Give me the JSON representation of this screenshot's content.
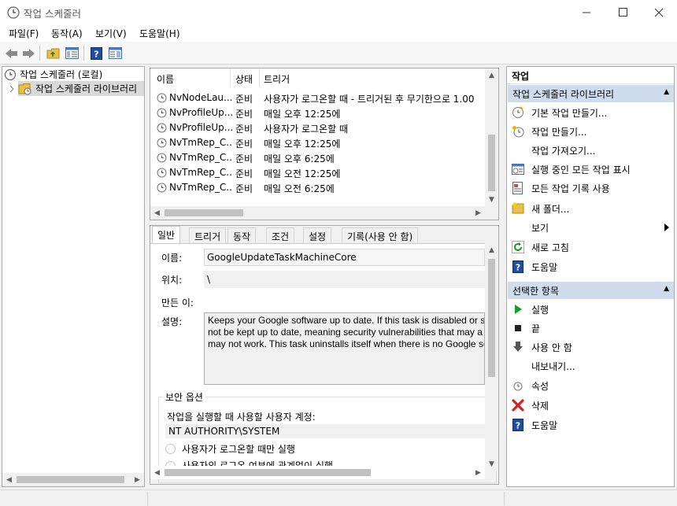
{
  "window": {
    "title": "작업 스케줄러"
  },
  "menu": [
    "파일(F)",
    "동작(A)",
    "보기(V)",
    "도움말(H)"
  ],
  "tree": {
    "root": "작업 스케줄러 (로컬)",
    "child": "작업 스케줄러 라이브러리"
  },
  "task_list": {
    "columns": [
      "이름",
      "상태",
      "트리거"
    ],
    "rows": [
      {
        "name": "NvNodeLau...",
        "status": "준비",
        "trigger": "사용자가 로그온할 때 - 트리거된 후 무기한으로 1.00"
      },
      {
        "name": "NvProfileUp...",
        "status": "준비",
        "trigger": "매일 오후 12:25에"
      },
      {
        "name": "NvProfileUp...",
        "status": "준비",
        "trigger": "사용자가 로그온할 때"
      },
      {
        "name": "NvTmRep_C...",
        "status": "준비",
        "trigger": "매일 오후 12:25에"
      },
      {
        "name": "NvTmRep_C...",
        "status": "준비",
        "trigger": "매일 오후 6:25에"
      },
      {
        "name": "NvTmRep_C...",
        "status": "준비",
        "trigger": "매일 오전 12:25에"
      },
      {
        "name": "NvTmRep_C...",
        "status": "준비",
        "trigger": "매일 오전 6:25에"
      }
    ]
  },
  "detail": {
    "tabs": [
      "일반",
      "트리거",
      "동작",
      "조건",
      "설정",
      "기록(사용 안 함)"
    ],
    "labels": {
      "name": "이름:",
      "location": "위치:",
      "author": "만든 이:",
      "description": "설명:"
    },
    "name_value": "GoogleUpdateTaskMachineCore",
    "location_value": "\\",
    "description_lines": [
      "Keeps your Google software up to date. If this task is disabled or st",
      "not be kept up to date, meaning security vulnerabilities that may a",
      "may not work. This task uninstalls itself when there is no Google so"
    ],
    "security": {
      "title": "보안 옵션",
      "account_label": "작업을 실행할 때 사용할 사용자 계정:",
      "account_value": "NT AUTHORITY\\SYSTEM",
      "option1": "사용자가 로그온할 때만 실행",
      "option2": "사용자의 로그온 여부에 관계없이 실행"
    }
  },
  "actions": {
    "title": "작업",
    "library_section": "작업 스케줄러 라이브러리",
    "library_items": [
      "기본 작업 만들기...",
      "작업 만들기...",
      "작업 가져오기...",
      "실행 중인 모든 작업 표시",
      "모든 작업 기록 사용",
      "새 폴더...",
      "보기",
      "새로 고침",
      "도움말"
    ],
    "selected_section": "선택한 항목",
    "selected_items": [
      "실행",
      "끝",
      "사용 안 함",
      "내보내기...",
      "속성",
      "삭제",
      "도움말"
    ]
  },
  "colors": {
    "section_header": "#cfdcec",
    "help_icon": "#1f4da0",
    "delete_icon": "#d42020",
    "run_icon": "#1a9c2a"
  }
}
